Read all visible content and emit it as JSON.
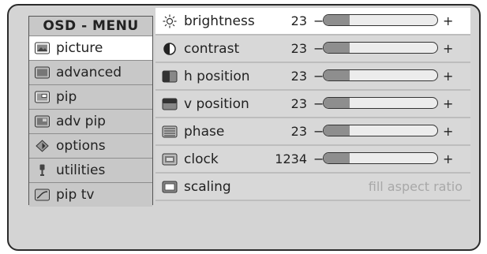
{
  "menu": {
    "title": "OSD - MENU",
    "items": [
      {
        "label": "picture",
        "icon": "picture-icon",
        "selected": true
      },
      {
        "label": "advanced",
        "icon": "advanced-icon",
        "selected": false
      },
      {
        "label": "pip",
        "icon": "pip-icon",
        "selected": false
      },
      {
        "label": "adv pip",
        "icon": "adv-pip-icon",
        "selected": false
      },
      {
        "label": "options",
        "icon": "options-icon",
        "selected": false
      },
      {
        "label": "utilities",
        "icon": "utilities-icon",
        "selected": false
      },
      {
        "label": "pip tv",
        "icon": "pip-tv-icon",
        "selected": false
      }
    ]
  },
  "settings": {
    "rows": [
      {
        "label": "brightness",
        "icon": "sun-icon",
        "value": "23",
        "level": 0.23,
        "selected": true
      },
      {
        "label": "contrast",
        "icon": "contrast-icon",
        "value": "23",
        "level": 0.23,
        "selected": false
      },
      {
        "label": "h position",
        "icon": "h-position-icon",
        "value": "23",
        "level": 0.23,
        "selected": false
      },
      {
        "label": "v position",
        "icon": "v-position-icon",
        "value": "23",
        "level": 0.23,
        "selected": false
      },
      {
        "label": "phase",
        "icon": "phase-icon",
        "value": "23",
        "level": 0.23,
        "selected": false
      },
      {
        "label": "clock",
        "icon": "clock-icon",
        "value": "1234",
        "level": 0.23,
        "selected": false
      }
    ],
    "scaling": {
      "label": "scaling",
      "icon": "scaling-icon",
      "options": "fill aspect ratio"
    }
  },
  "controls": {
    "minus": "−",
    "plus": "+"
  }
}
